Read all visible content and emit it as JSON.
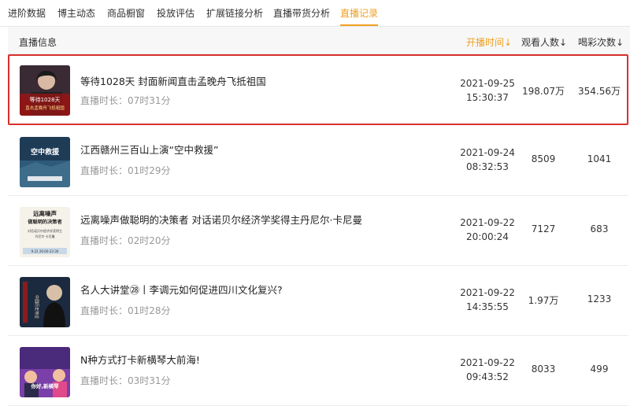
{
  "tabs": [
    {
      "label": "进阶数据"
    },
    {
      "label": "博主动态"
    },
    {
      "label": "商品橱窗"
    },
    {
      "label": "投放评估"
    },
    {
      "label": "扩展链接分析"
    },
    {
      "label": "直播带货分析"
    },
    {
      "label": "直播记录"
    }
  ],
  "header": {
    "info": "直播信息",
    "start_time": "开播时间",
    "views": "观看人数",
    "likes": "喝彩次数",
    "sort_arrow": "↓"
  },
  "rows": [
    {
      "title": "等待1028天 封面新闻直击孟晚舟飞抵祖国",
      "duration": "直播时长：07时31分",
      "date": "2021-09-25",
      "time": "15:30:37",
      "views": "198.07万",
      "likes": "354.56万"
    },
    {
      "title": "江西赣州三百山上演“空中救援”",
      "duration": "直播时长：01时29分",
      "date": "2021-09-24",
      "time": "08:32:53",
      "views": "8509",
      "likes": "1041"
    },
    {
      "title": "远离噪声做聪明的决策者 对话诺贝尔经济学奖得主丹尼尔·卡尼曼",
      "duration": "直播时长：02时20分",
      "date": "2021-09-22",
      "time": "20:00:24",
      "views": "7127",
      "likes": "683"
    },
    {
      "title": "名人大讲堂㉘丨李调元如何促进四川文化复兴?",
      "duration": "直播时长：01时28分",
      "date": "2021-09-22",
      "time": "14:35:55",
      "views": "1.97万",
      "likes": "1233"
    },
    {
      "title": "N种方式打卡新横琴大前海!",
      "duration": "直播时长：03时31分",
      "date": "2021-09-22",
      "time": "09:43:52",
      "views": "8033",
      "likes": "499"
    }
  ],
  "thumbnails": {
    "t1": {
      "line1": "等待1028天",
      "line2": "直击孟晚舟飞抵祖国"
    },
    "t2": {
      "label": "空中救援"
    },
    "t3": {
      "line1": "远离噪声",
      "line2": "做聪明的决策者",
      "line3": "对话诺贝尔经济学奖得主",
      "line4": "丹尼尔·卡尼曼",
      "line5": "9.22 20:00-22:30"
    },
    "t4": {
      "label": "中国历史地位"
    },
    "t5": {
      "label": "你好,新横琴"
    }
  },
  "colors": {
    "accent": "#f0a020",
    "highlight": "#d9302c"
  }
}
